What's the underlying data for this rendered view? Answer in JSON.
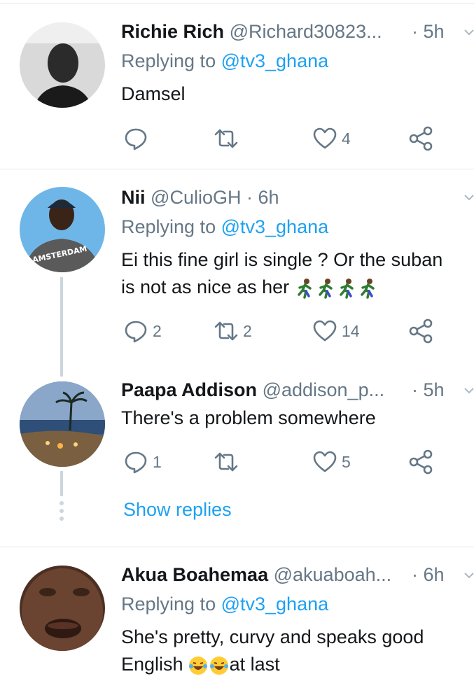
{
  "tweets": [
    {
      "name": "Richie Rich",
      "handle": "@Richard30823...",
      "time": "· 5h",
      "replying_prefix": "Replying to ",
      "replying_to": "@tv3_ghana",
      "text_lines": [
        "Damsel"
      ],
      "replies": "",
      "retweets": "",
      "likes": "4"
    },
    {
      "name": "Nii",
      "handle": "@CulioGH · 6h",
      "replying_prefix": "Replying to ",
      "replying_to": "@tv3_ghana",
      "text_lines": [
        "Ei this fine girl is single ? Or the suban",
        "is not as nice as her"
      ],
      "avatar_text": "AMSTERDAM",
      "replies": "2",
      "retweets": "2",
      "likes": "14"
    },
    {
      "name": "Paapa Addison",
      "handle": "@addison_p...",
      "time": "· 5h",
      "text_lines": [
        "There's a problem somewhere"
      ],
      "replies": "1",
      "retweets": "",
      "likes": "5"
    },
    {
      "name": "Akua Boahemaa",
      "handle": "@akuaboah...",
      "time": "· 6h",
      "replying_prefix": "Replying to ",
      "replying_to": "@tv3_ghana",
      "text_lines": [
        "She's pretty, curvy and speaks good",
        "English",
        "at last"
      ]
    }
  ],
  "show_replies": "Show replies",
  "icons": [
    "reply-icon",
    "retweet-icon",
    "like-icon",
    "share-icon",
    "chevron-down-icon"
  ],
  "colors": {
    "accent": "#1da1f2",
    "secondary_text": "#657786",
    "divider": "#e1e8ed",
    "thread_line": "#ccd6dd"
  }
}
